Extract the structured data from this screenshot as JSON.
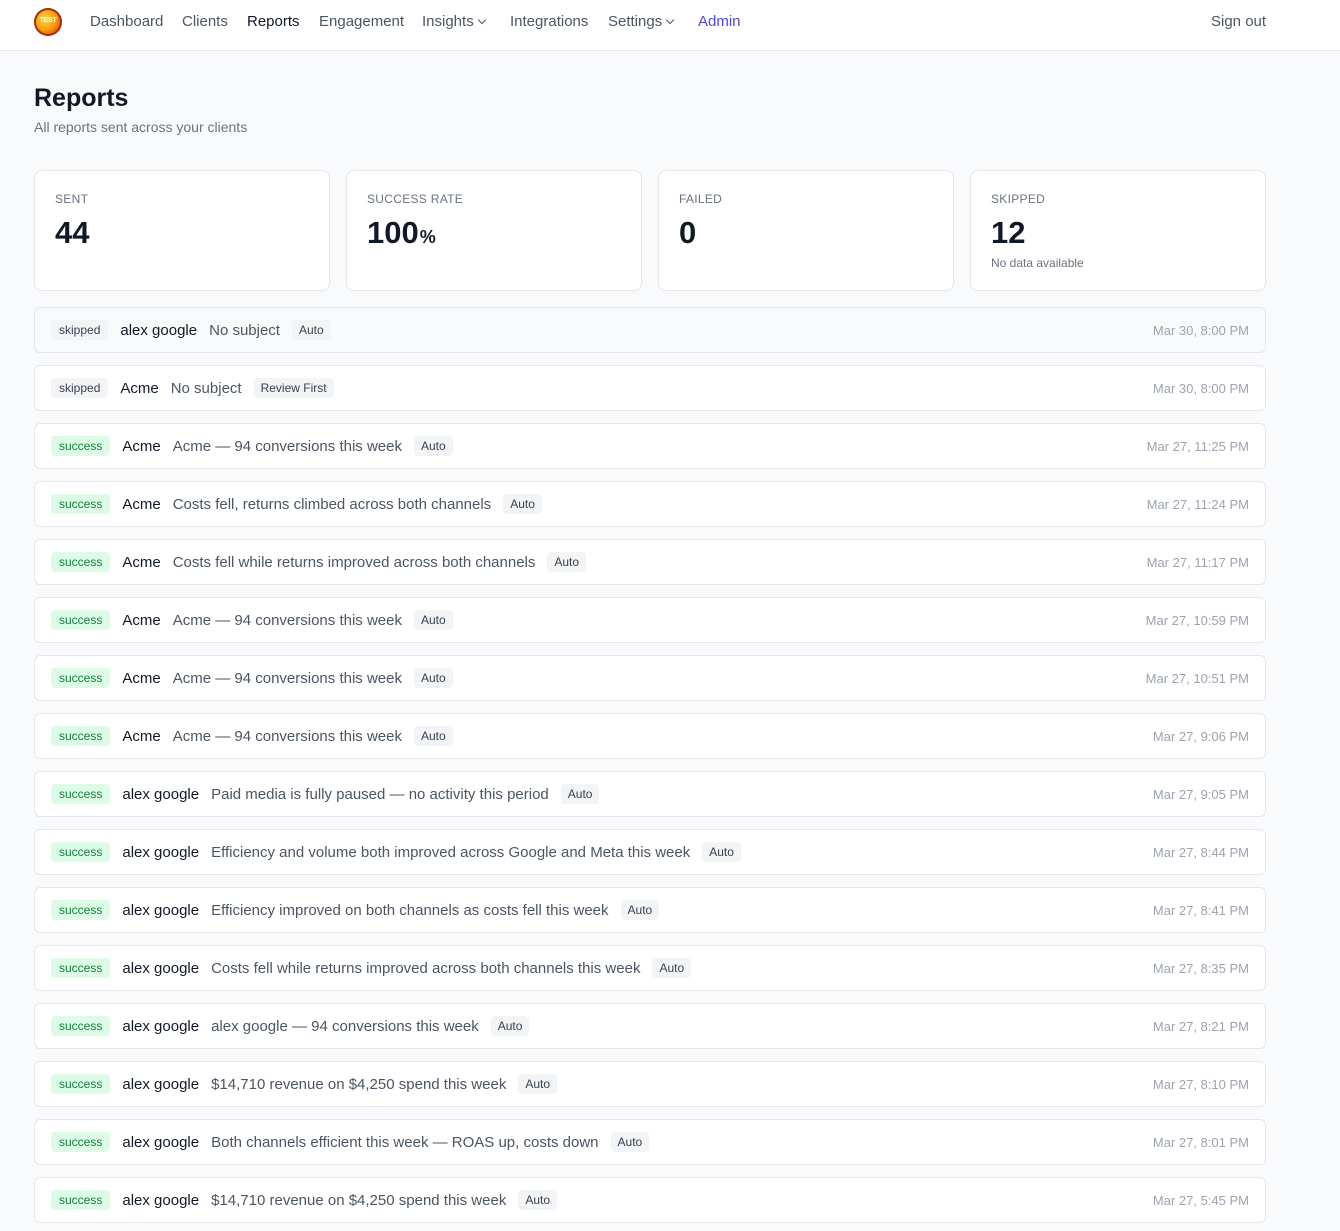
{
  "nav": {
    "logo_text": "TEST",
    "items": [
      {
        "label": "Dashboard"
      },
      {
        "label": "Clients"
      },
      {
        "label": "Reports"
      },
      {
        "label": "Engagement"
      },
      {
        "label": "Insights"
      },
      {
        "label": "Integrations"
      },
      {
        "label": "Settings"
      },
      {
        "label": "Admin"
      }
    ],
    "sign_out": "Sign out",
    "active": "Reports"
  },
  "header": {
    "title": "Reports",
    "subtitle": "All reports sent across your clients"
  },
  "stats": [
    {
      "label": "SENT",
      "value": "44",
      "unit": "",
      "note": ""
    },
    {
      "label": "SUCCESS RATE",
      "value": "100",
      "unit": "%",
      "note": ""
    },
    {
      "label": "FAILED",
      "value": "0",
      "unit": "",
      "note": ""
    },
    {
      "label": "SKIPPED",
      "value": "12",
      "unit": "",
      "note": "No data available"
    }
  ],
  "reports": [
    {
      "status": "skipped",
      "client": "alex google",
      "subject": "No subject",
      "mode": "Auto",
      "time": "Mar 30, 8:00 PM"
    },
    {
      "status": "skipped",
      "client": "Acme",
      "subject": "No subject",
      "mode": "Review First",
      "time": "Mar 30, 8:00 PM"
    },
    {
      "status": "success",
      "client": "Acme",
      "subject": "Acme — 94 conversions this week",
      "mode": "Auto",
      "time": "Mar 27, 11:25 PM"
    },
    {
      "status": "success",
      "client": "Acme",
      "subject": "Costs fell, returns climbed across both channels",
      "mode": "Auto",
      "time": "Mar 27, 11:24 PM"
    },
    {
      "status": "success",
      "client": "Acme",
      "subject": "Costs fell while returns improved across both channels",
      "mode": "Auto",
      "time": "Mar 27, 11:17 PM"
    },
    {
      "status": "success",
      "client": "Acme",
      "subject": "Acme — 94 conversions this week",
      "mode": "Auto",
      "time": "Mar 27, 10:59 PM"
    },
    {
      "status": "success",
      "client": "Acme",
      "subject": "Acme — 94 conversions this week",
      "mode": "Auto",
      "time": "Mar 27, 10:51 PM"
    },
    {
      "status": "success",
      "client": "Acme",
      "subject": "Acme — 94 conversions this week",
      "mode": "Auto",
      "time": "Mar 27, 9:06 PM"
    },
    {
      "status": "success",
      "client": "alex google",
      "subject": "Paid media is fully paused — no activity this period",
      "mode": "Auto",
      "time": "Mar 27, 9:05 PM"
    },
    {
      "status": "success",
      "client": "alex google",
      "subject": "Efficiency and volume both improved across Google and Meta this week",
      "mode": "Auto",
      "time": "Mar 27, 8:44 PM"
    },
    {
      "status": "success",
      "client": "alex google",
      "subject": "Efficiency improved on both channels as costs fell this week",
      "mode": "Auto",
      "time": "Mar 27, 8:41 PM"
    },
    {
      "status": "success",
      "client": "alex google",
      "subject": "Costs fell while returns improved across both channels this week",
      "mode": "Auto",
      "time": "Mar 27, 8:35 PM"
    },
    {
      "status": "success",
      "client": "alex google",
      "subject": "alex google — 94 conversions this week",
      "mode": "Auto",
      "time": "Mar 27, 8:21 PM"
    },
    {
      "status": "success",
      "client": "alex google",
      "subject": "$14,710 revenue on $4,250 spend this week",
      "mode": "Auto",
      "time": "Mar 27, 8:10 PM"
    },
    {
      "status": "success",
      "client": "alex google",
      "subject": "Both channels efficient this week — ROAS up, costs down",
      "mode": "Auto",
      "time": "Mar 27, 8:01 PM"
    },
    {
      "status": "success",
      "client": "alex google",
      "subject": "$14,710 revenue on $4,250 spend this week",
      "mode": "Auto",
      "time": "Mar 27, 5:45 PM"
    }
  ]
}
